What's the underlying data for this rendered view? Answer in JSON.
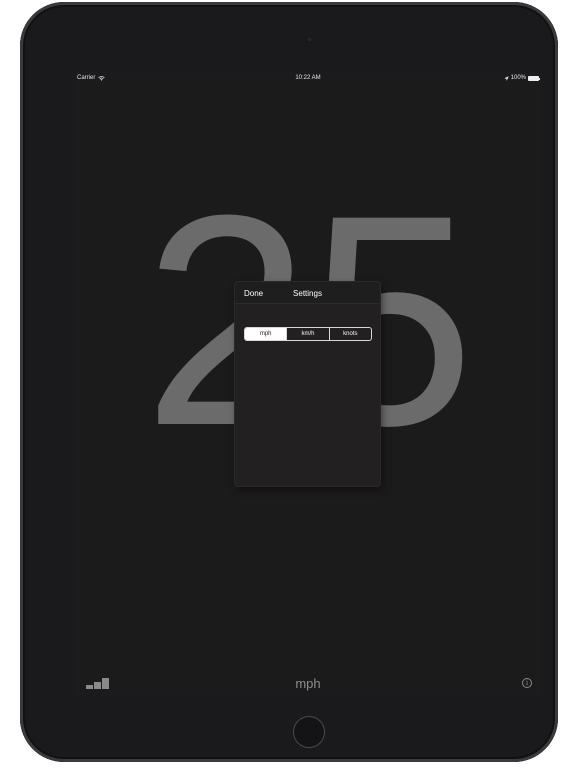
{
  "status_bar": {
    "carrier": "Carrier",
    "time": "10:22 AM",
    "battery": "100%",
    "icons": [
      "wifi-icon",
      "location-arrow-icon",
      "battery-icon"
    ]
  },
  "speed": {
    "value": "25",
    "unit": "mph"
  },
  "settings_popover": {
    "done_label": "Done",
    "title": "Settings",
    "units": [
      {
        "label": "mph",
        "selected": true
      },
      {
        "label": "km/h",
        "selected": false
      },
      {
        "label": "knots",
        "selected": false
      }
    ]
  },
  "bottom_bar": {
    "signal_icon": "signal-strength-icon",
    "info_icon": "info-icon",
    "info_glyph": "i"
  },
  "colors": {
    "background": "#1b1b1b",
    "speed_digits": "#6b6b6b",
    "popover": "#222020",
    "selected_segment": "#ffffff"
  }
}
